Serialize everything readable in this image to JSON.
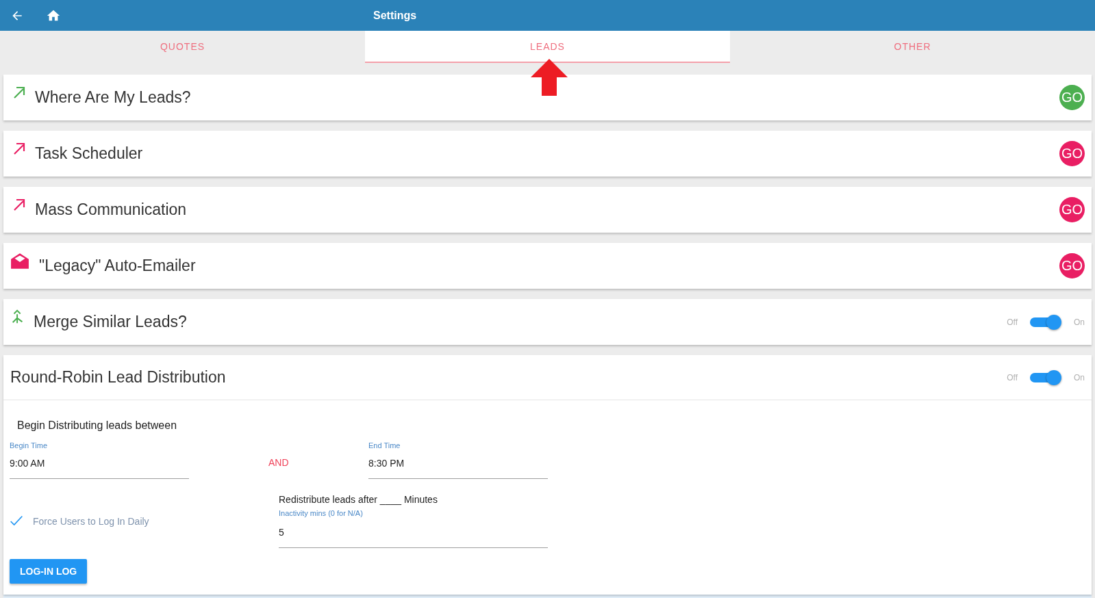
{
  "header": {
    "title": "Settings"
  },
  "tabs": [
    {
      "label": "QUOTES",
      "selected": false
    },
    {
      "label": "LEADS",
      "selected": true
    },
    {
      "label": "OTHER",
      "selected": false
    }
  ],
  "rows": [
    {
      "kind": "link",
      "title": "Where Are My Leads?",
      "action": "GO",
      "color": "#4caf50"
    },
    {
      "kind": "link",
      "title": "Task Scheduler",
      "action": "GO",
      "color": "#e91e63"
    },
    {
      "kind": "link",
      "title": "Mass Communication",
      "action": "GO",
      "color": "#e91e63"
    },
    {
      "kind": "mail",
      "title": "\"Legacy\" Auto-Emailer",
      "action": "GO",
      "color": "#e91e63"
    },
    {
      "kind": "toggle",
      "title": "Merge Similar Leads?",
      "off_label": "Off",
      "on_label": "On",
      "on": true,
      "color": "#4caf50"
    }
  ],
  "round_robin": {
    "title": "Round-Robin Lead Distribution",
    "off_label": "Off",
    "on_label": "On",
    "on": true,
    "heading": "Begin Distributing leads between",
    "begin_time": {
      "label": "Begin Time",
      "value": "9:00 AM"
    },
    "and_label": "AND",
    "end_time": {
      "label": "End Time",
      "value": "8:30 PM"
    },
    "force_login": {
      "label": "Force Users to Log In Daily",
      "checked": true
    },
    "redistribute": {
      "label": "Redistribute leads after ____ Minutes",
      "field_label": "Inactivity mins (0 for N/A)",
      "value": "5"
    },
    "button": "LOG-IN LOG"
  }
}
